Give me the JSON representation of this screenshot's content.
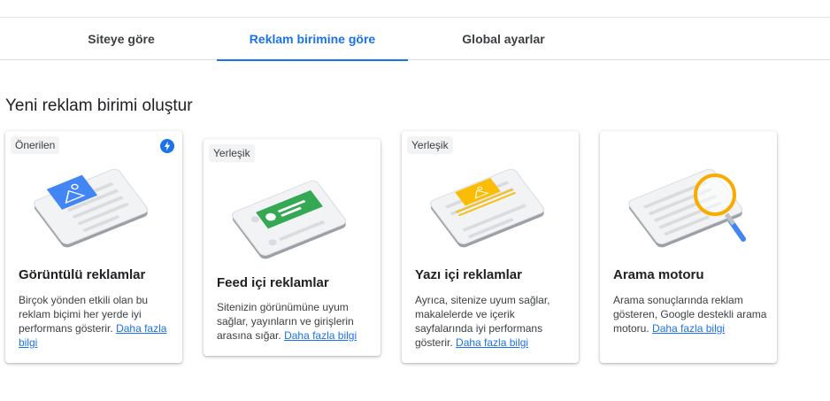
{
  "tabs": [
    {
      "label": "Siteye göre",
      "active": false
    },
    {
      "label": "Reklam birimine göre",
      "active": true
    },
    {
      "label": "Global ayarlar",
      "active": false
    }
  ],
  "section_title": "Yeni reklam birimi oluştur",
  "colors": {
    "accent": "#1a73e8",
    "display": "#4285f4",
    "feed": "#34a853",
    "article": "#fbbc04",
    "search": "#f9ab00"
  },
  "cards": [
    {
      "badge": "Önerilen",
      "title": "Görüntülü reklamlar",
      "desc": "Birçok yönden etkili olan bu reklam biçimi her yerde iyi performans gösterir.",
      "link": "Daha fazla bilgi",
      "icon": "lightning-bolt-icon"
    },
    {
      "badge": "Yerleşik",
      "title": "Feed içi reklamlar",
      "desc": "Sitenizin görünümüne uyum sağlar, yayınların ve girişlerin arasına sığar.",
      "link": "Daha fazla bilgi"
    },
    {
      "badge": "Yerleşik",
      "title": "Yazı içi reklamlar",
      "desc": "Ayrıca, sitenize uyum sağlar, makalelerde ve içerik sayfalarında iyi performans gösterir.",
      "link": "Daha fazla bilgi"
    },
    {
      "title": "Arama motoru",
      "desc": "Arama sonuçlarında reklam gösteren, Google destekli arama motoru.",
      "link": "Daha fazla bilgi"
    }
  ]
}
